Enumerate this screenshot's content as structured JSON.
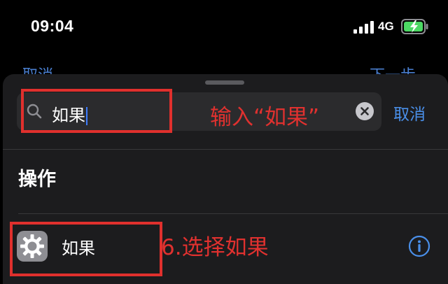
{
  "status_bar": {
    "time": "09:04",
    "network": "4G",
    "battery_color": "#4cd964"
  },
  "background_nav": {
    "cancel_label": "取消",
    "next_label": "下一步"
  },
  "search": {
    "value": "如果",
    "cancel_label": "取消"
  },
  "annotations": {
    "input_hint": "输入“如果”",
    "select_hint": "6.选择如果",
    "color": "#e0302d"
  },
  "section": {
    "title": "操作"
  },
  "results": [
    {
      "label": "如果",
      "icon": "gear-icon"
    }
  ],
  "colors": {
    "accent": "#4a8fe9",
    "sheet_bg": "#1c1c1e",
    "field_bg": "#2b2b2d"
  }
}
